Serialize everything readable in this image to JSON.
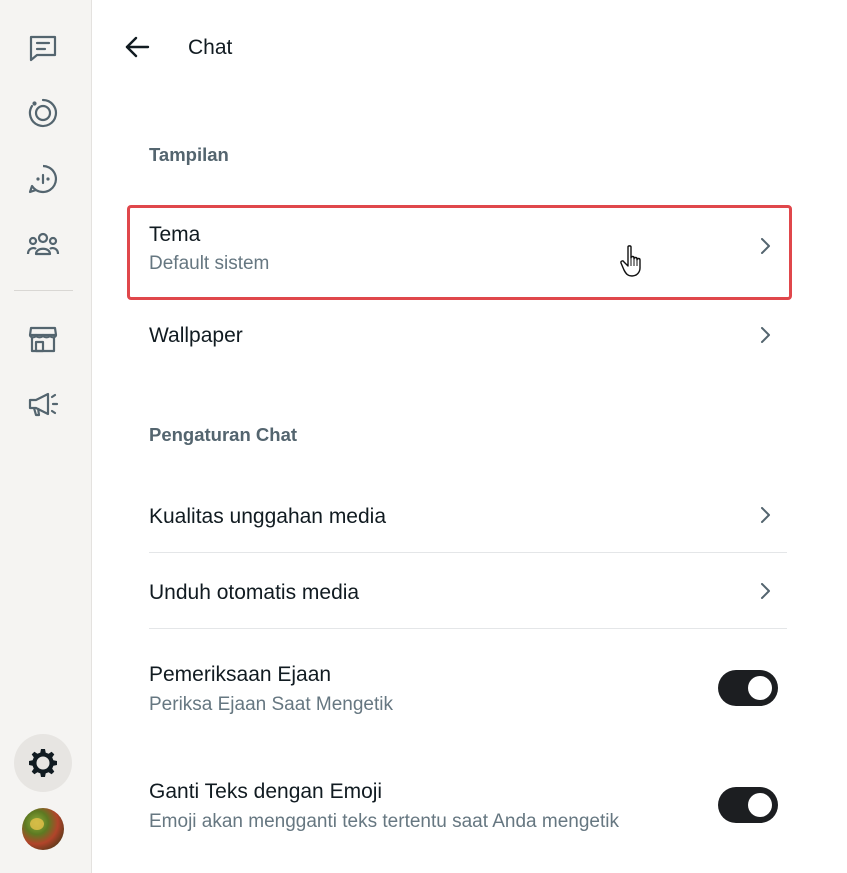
{
  "header": {
    "title": "Chat"
  },
  "sections": {
    "appearance": "Tampilan",
    "chat_settings": "Pengaturan Chat"
  },
  "items": {
    "theme": {
      "label": "Tema",
      "value": "Default sistem"
    },
    "wallpaper": {
      "label": "Wallpaper"
    },
    "media_quality": {
      "label": "Kualitas unggahan media"
    },
    "auto_download": {
      "label": "Unduh otomatis media"
    },
    "spell_check": {
      "label": "Pemeriksaan Ejaan",
      "description": "Periksa Ejaan Saat Mengetik",
      "enabled": true
    },
    "emoji_replace": {
      "label": "Ganti Teks dengan Emoji",
      "description": "Emoji akan mengganti teks tertentu saat Anda mengetik",
      "enabled": true
    }
  },
  "sidebar": {
    "icons": [
      "chats-icon",
      "status-icon",
      "channels-icon",
      "communities-icon",
      "catalog-icon",
      "ads-icon",
      "settings-icon",
      "profile-avatar"
    ]
  },
  "colors": {
    "highlight_border": "#e0474b",
    "toggle_on": "#1c1e21",
    "rail_bg": "#f5f4f2"
  }
}
